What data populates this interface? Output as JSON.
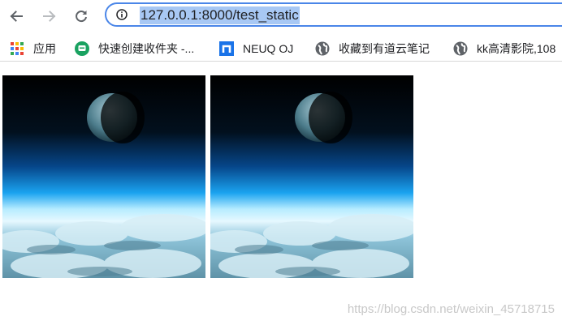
{
  "browser": {
    "url": "127.0.0.1:8000/test_static",
    "buttons": {
      "back": "back-arrow-icon",
      "forward": "forward-arrow-icon",
      "reload": "reload-icon",
      "site_info": "info-icon"
    }
  },
  "bookmarks": [
    {
      "label": "应用",
      "icon": "apps-grid-icon"
    },
    {
      "label": "快速创建收件夹 -...",
      "icon": "green-chat-icon"
    },
    {
      "label": "NEUQ OJ",
      "icon": "blue-n-icon"
    },
    {
      "label": "收藏到有道云笔记",
      "icon": "globe-icon"
    },
    {
      "label": "kk高清影院,108",
      "icon": "globe-icon"
    }
  ],
  "page": {
    "images": [
      {
        "alt": "planet-over-clouds-image-1"
      },
      {
        "alt": "planet-over-clouds-image-2"
      }
    ],
    "watermark": "https://blog.csdn.net/weixin_45718715"
  },
  "colors": {
    "omnibox_border": "#4a86e8",
    "url_highlight": "#a8c8f4",
    "neuq_blue": "#1a73e8",
    "chat_green": "#1aa261"
  }
}
